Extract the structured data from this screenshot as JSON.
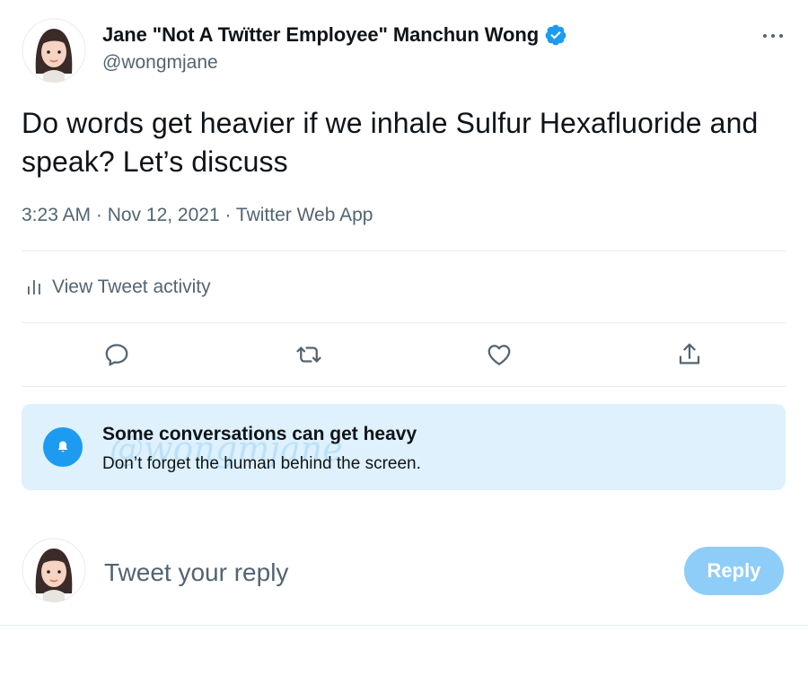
{
  "author": {
    "name": "Jane \"Not A Twïtter Employee\" Manchun Wong",
    "handle": "@wongmjane",
    "verified": true
  },
  "tweet": {
    "text": "Do words get heavier if we inhale Sulfur Hexafluoride and speak? Let’s discuss",
    "meta": "3:23 AM · Nov 12, 2021 · Twitter Web App"
  },
  "activity": {
    "label": "View Tweet activity"
  },
  "actions": {
    "icons": [
      "reply-icon",
      "retweet-icon",
      "like-icon",
      "share-icon"
    ]
  },
  "notice": {
    "title": "Some conversations can get heavy",
    "body": "Don’t forget the human behind the screen.",
    "watermark": "@wongmjane"
  },
  "composer": {
    "placeholder": "Tweet your reply",
    "reply_label": "Reply"
  },
  "colors": {
    "accent": "#1d9bf0",
    "secondary_text": "#536471",
    "notice_bg": "#def1fc",
    "reply_disabled": "#8ecdf8"
  }
}
